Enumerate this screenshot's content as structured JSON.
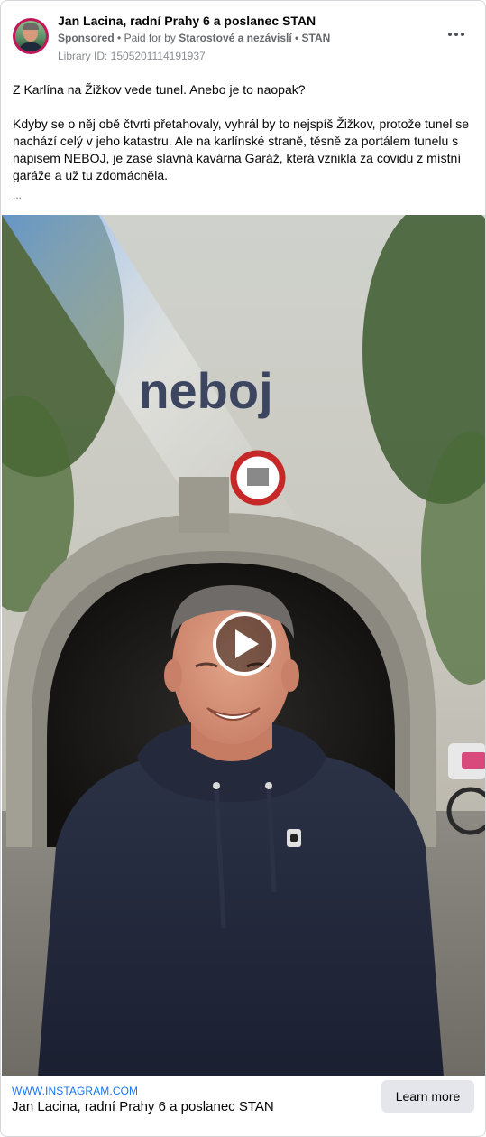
{
  "header": {
    "page_name": "Jan Lacina, radní Prahy 6 a poslanec STAN",
    "sponsored": "Sponsored",
    "paid_prefix": "Paid for by",
    "paid_by": "Starostové a nezávislí • STAN",
    "library_id": "Library ID: 1505201114191937"
  },
  "post": {
    "text_line1": "Z Karlína na Žižkov vede tunel. Anebo je to naopak?",
    "text_paragraph2": "Kdyby se o něj obě čtvrti přetahovaly, vyhrál by to nejspíš Žižkov, protože tunel se nachází celý v jeho katastru. Ale na karlínské straně, těsně za portálem tunelu s nápisem NEBOJ, je zase slavná kavárna Garáž, která vznikla za covidu z místní garáže a už tu zdomácněla.",
    "truncation": "..."
  },
  "video": {
    "sign_text": "neboj",
    "play_icon": "play-icon"
  },
  "link": {
    "domain": "WWW.INSTAGRAM.COM",
    "title": "Jan Lacina, radní Prahy 6 a poslanec STAN",
    "cta": "Learn more"
  },
  "colors": {
    "link_blue": "#1877f2",
    "cta_bg": "#e4e6eb",
    "avatar_ring": "#c2185b"
  }
}
